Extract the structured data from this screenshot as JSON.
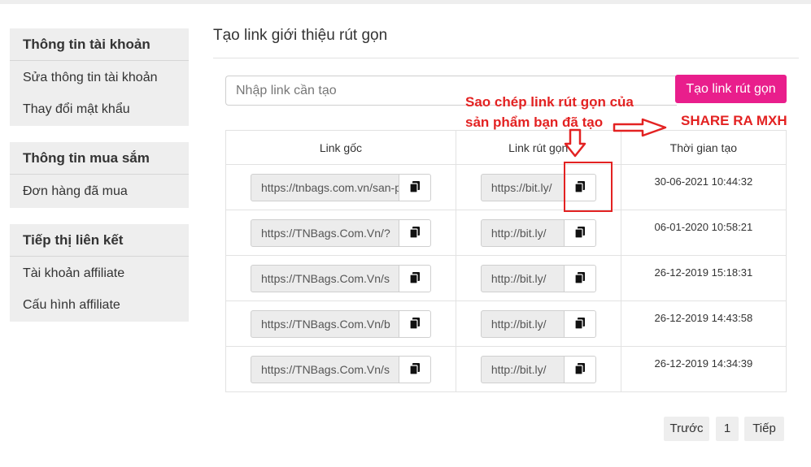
{
  "sidebar": {
    "groups": [
      {
        "title": "Thông tin tài khoản",
        "items": [
          "Sửa thông tin tài khoản",
          "Thay đổi mật khẩu"
        ]
      },
      {
        "title": "Thông tin mua sắm",
        "items": [
          "Đơn hàng đã mua"
        ]
      },
      {
        "title": "Tiếp thị liên kết",
        "items": [
          "Tài khoản affiliate",
          "Cấu hình affiliate"
        ]
      }
    ]
  },
  "main": {
    "title": "Tạo link giới thiệu rút gọn",
    "input_placeholder": "Nhập link cần tạo",
    "create_button": "Tạo link rút gọn",
    "table": {
      "headers": [
        "Link gốc",
        "Link rút gọn",
        "Thời gian tạo"
      ],
      "rows": [
        {
          "original": "https://tnbags.com.vn/san-pham",
          "short": "https://bit.ly/",
          "created": "30-06-2021 10:44:32"
        },
        {
          "original": "https://TNBags.Com.Vn/?",
          "short": "http://bit.ly/",
          "created": "06-01-2020 10:58:21"
        },
        {
          "original": "https://TNBags.Com.Vn/s",
          "short": "http://bit.ly/",
          "created": "26-12-2019 15:18:31"
        },
        {
          "original": "https://TNBags.Com.Vn/b",
          "short": "http://bit.ly/",
          "created": "26-12-2019 14:43:58"
        },
        {
          "original": "https://TNBags.Com.Vn/s",
          "short": "http://bit.ly/",
          "created": "26-12-2019 14:34:39"
        }
      ]
    },
    "pagination": {
      "prev": "Trước",
      "page": "1",
      "next": "Tiếp"
    }
  },
  "annotations": {
    "copy_hint_line1": "Sao chép link rút gọn của",
    "copy_hint_line2": "sản phẩm bạn đã tạo",
    "share": "SHARE RA MXH"
  },
  "colors": {
    "accent": "#e91e8c",
    "annotation": "#e32222"
  },
  "icons": {
    "copy": "copy-icon"
  }
}
